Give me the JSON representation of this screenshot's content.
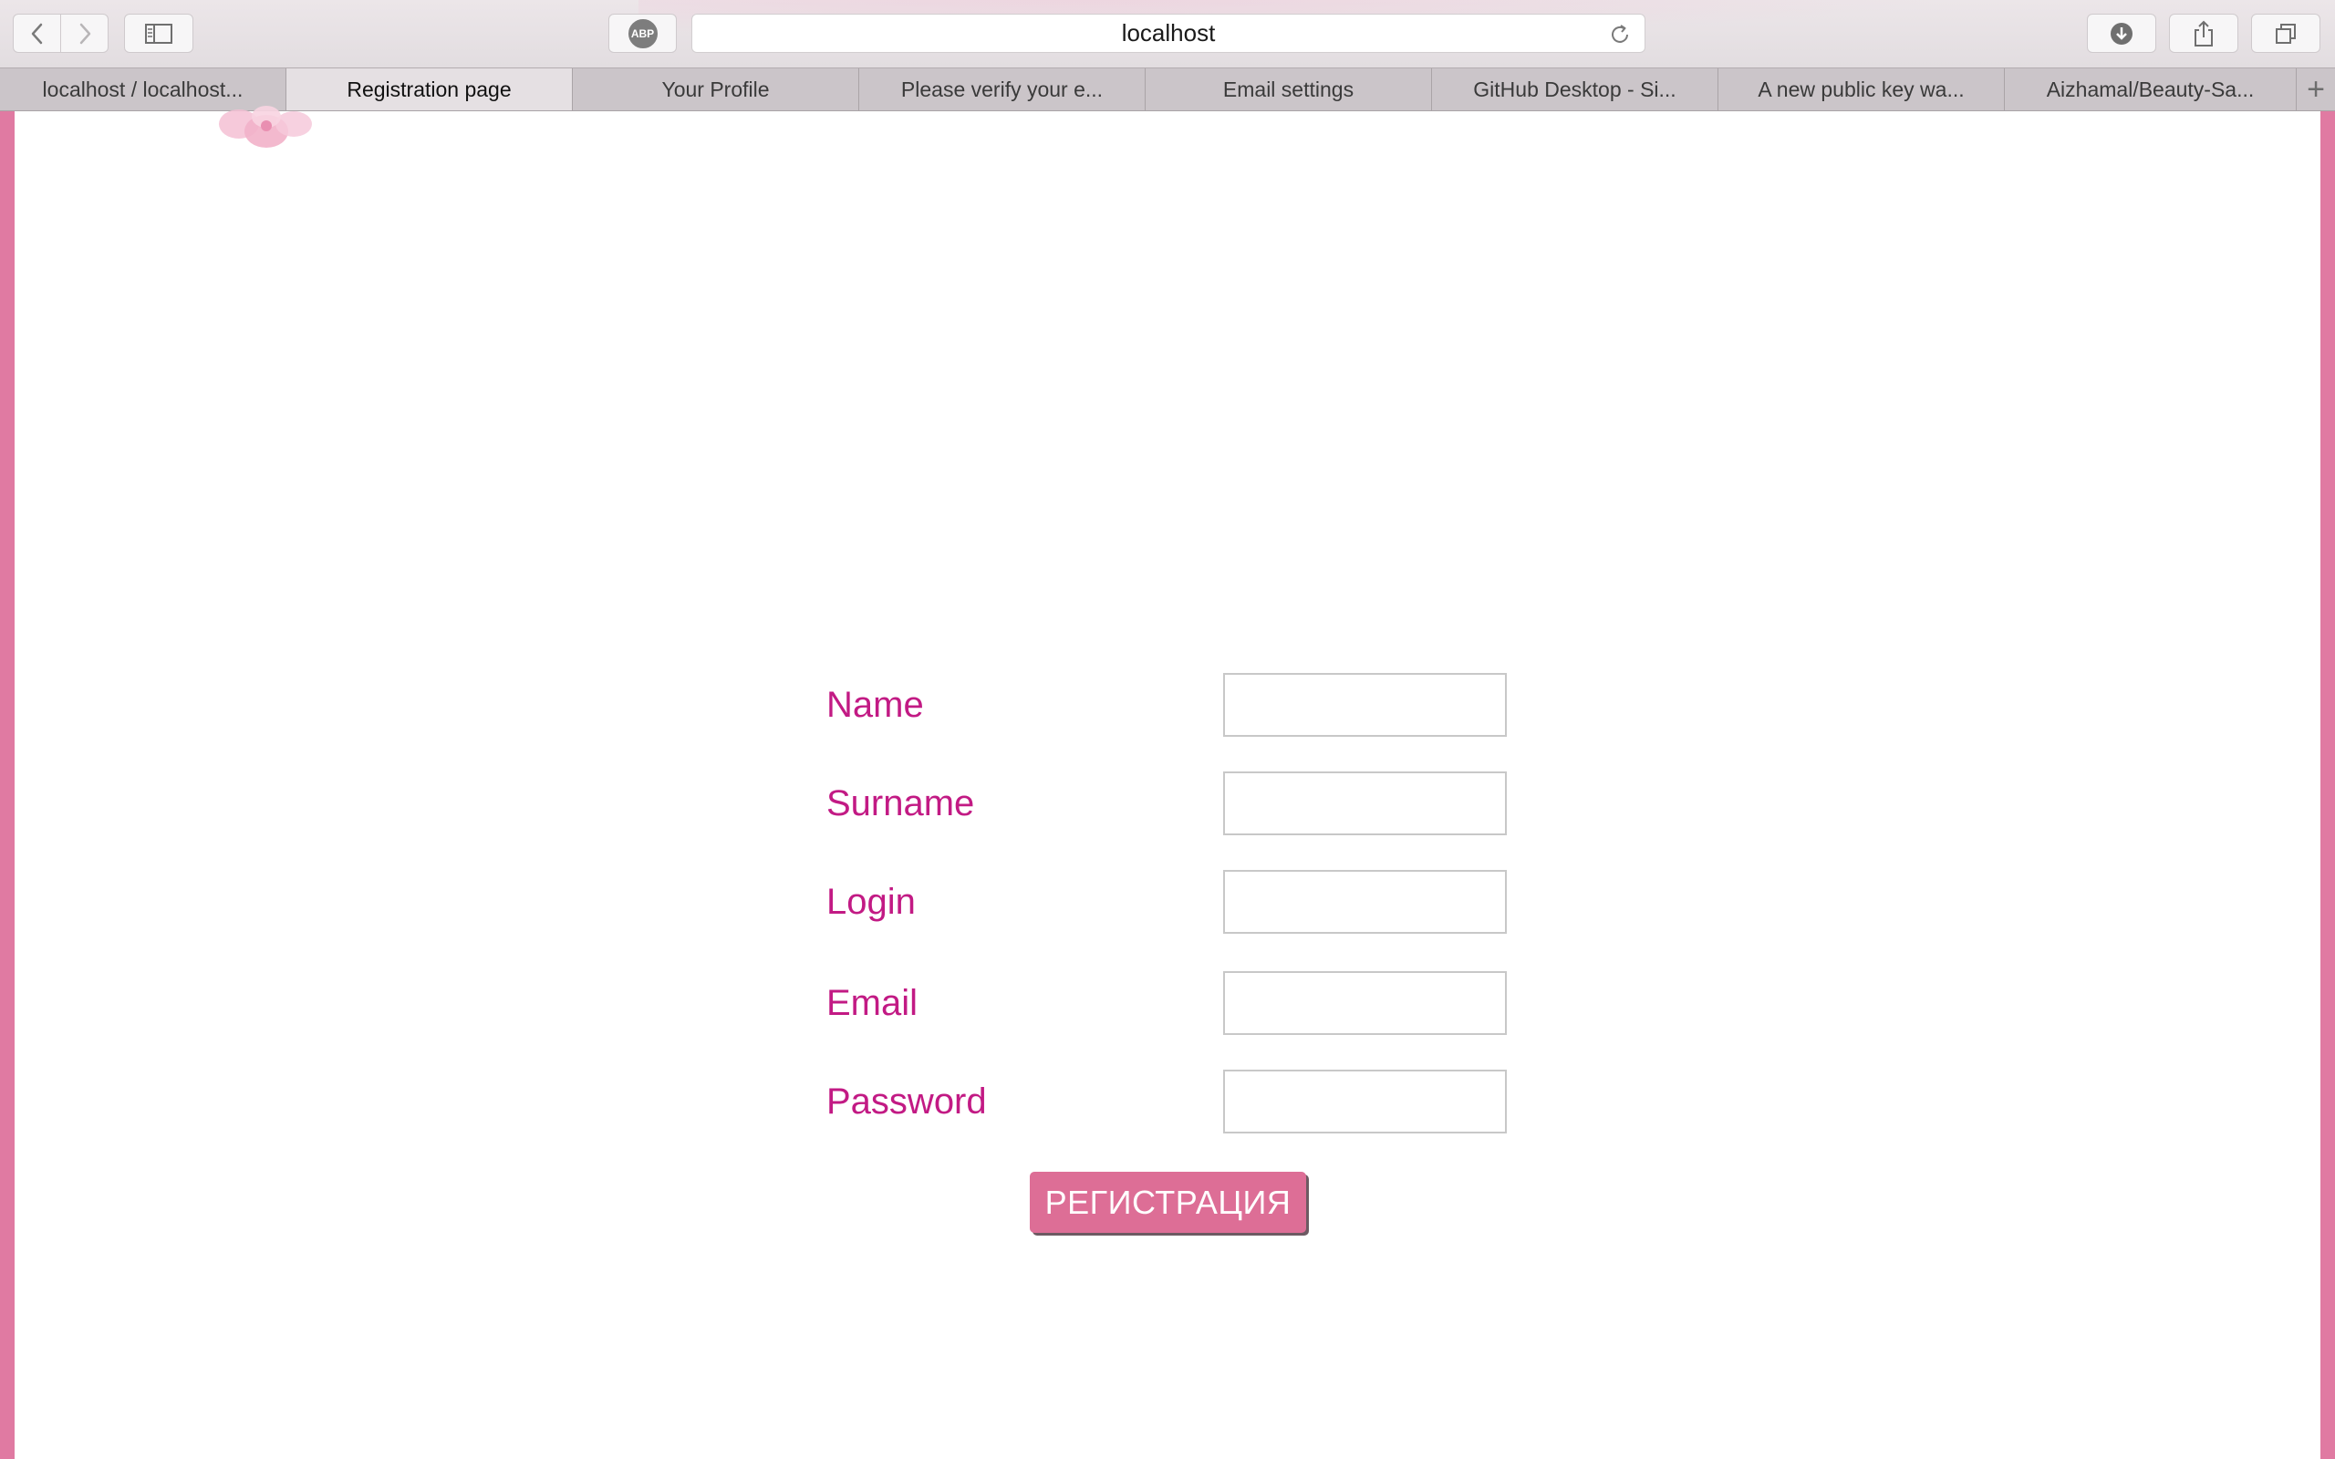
{
  "browser": {
    "address": "localhost",
    "abp_label": "ABP",
    "icons": {
      "back": "chevron-left-icon",
      "forward": "chevron-right-icon",
      "sidebar": "sidebar-icon",
      "reload": "reload-icon",
      "download": "download-icon",
      "share": "share-icon",
      "tabs": "tabs-overview-icon",
      "new_tab": "plus-icon"
    },
    "new_tab_label": "+"
  },
  "tabs": [
    {
      "label": "localhost / localhost...",
      "active": false
    },
    {
      "label": "Registration page",
      "active": true
    },
    {
      "label": "Your Profile",
      "active": false
    },
    {
      "label": "Please verify your e...",
      "active": false
    },
    {
      "label": "Email settings",
      "active": false
    },
    {
      "label": "GitHub Desktop - Si...",
      "active": false
    },
    {
      "label": "A new public key wa...",
      "active": false
    },
    {
      "label": "Aizhamal/Beauty-Sa...",
      "active": false
    }
  ],
  "form": {
    "fields": [
      {
        "label": "Name",
        "value": "",
        "placeholder": ""
      },
      {
        "label": "Surname",
        "value": "",
        "placeholder": ""
      },
      {
        "label": "Login",
        "value": "",
        "placeholder": ""
      },
      {
        "label": "Email",
        "value": "",
        "placeholder": ""
      },
      {
        "label": "Password",
        "value": "",
        "placeholder": ""
      }
    ],
    "submit_label": "РЕГИСТРАЦИЯ"
  },
  "colors": {
    "label": "#c21a84",
    "button": "#dd6e96",
    "frame": "#e07aa2"
  }
}
